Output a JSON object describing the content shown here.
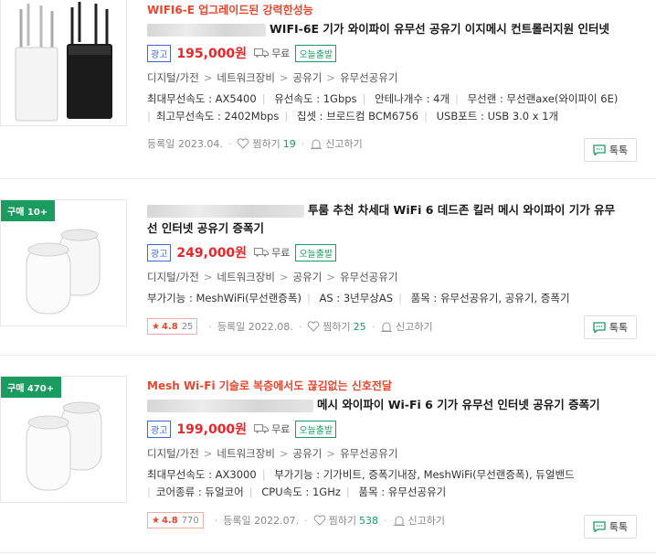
{
  "products": [
    {
      "badge": "",
      "promo": "WIFI6-E 업그레이드된 강력한성능",
      "title": "WIFI-6E 기가 와이파이 유무선 공유기 이지메시 컨트롤러지원 인터넷",
      "title2": "",
      "ad_label": "광고",
      "price": "195,000원",
      "shipping": "무료",
      "today": "오늘출발",
      "categories": [
        "디지털/가전",
        "네트워크장비",
        "공유기",
        "유무선공유기"
      ],
      "specs_line1": [
        "최대무선속도 : AX5400",
        "유선속도 : 1Gbps",
        "안테나개수 : 4개",
        "무선랜 : 무선랜axe(와이파이 6E)"
      ],
      "specs_line2": [
        "최고무선속도 : 2402Mbps",
        "칩셋 : 브로드컴 BCM6756",
        "USB포트 : USB 3.0 x 1개"
      ],
      "rating": "",
      "review_count": "",
      "date": "등록일 2023.04.",
      "wish_label": "찜하기",
      "wish_count": "19",
      "report": "신고하기",
      "talk": "톡톡"
    },
    {
      "badge": "구매 10+",
      "promo": "",
      "title": "투룸 추천 차세대 WiFi 6 데드존 킬러 메시 와이파이 기가 유무",
      "title2": "선 인터넷 공유기 증폭기",
      "ad_label": "광고",
      "price": "249,000원",
      "shipping": "무료",
      "today": "오늘출발",
      "categories": [
        "디지털/가전",
        "네트워크장비",
        "공유기",
        "유무선공유기"
      ],
      "specs_line1": [
        "부가기능 : MeshWiFi(무선랜증폭)",
        "AS : 3년무상AS",
        "품목 : 유무선공유기, 공유기, 증폭기"
      ],
      "specs_line2": [],
      "rating": "4.8",
      "review_count": "25",
      "date": "등록일 2022.08.",
      "wish_label": "찜하기",
      "wish_count": "25",
      "report": "신고하기",
      "talk": "톡톡"
    },
    {
      "badge": "구매 470+",
      "promo": "Mesh Wi-Fi 기술로 복층에서도 끊김없는 신호전달",
      "title": "메시 와이파이 Wi-Fi 6 기가 유무선 인터넷 공유기 증폭기",
      "title2": "",
      "ad_label": "광고",
      "price": "199,000원",
      "shipping": "무료",
      "today": "오늘출발",
      "categories": [
        "디지털/가전",
        "네트워크장비",
        "공유기",
        "유무선공유기"
      ],
      "specs_line1": [
        "최대무선속도 : AX3000",
        "부가기능 : 기가비트, 증폭기내장, MeshWiFi(무선랜증폭), 듀얼밴드"
      ],
      "specs_line2": [
        "코어종류 : 듀얼코어",
        "CPU속도 : 1GHz",
        "품목 : 유무선공유기"
      ],
      "rating": "4.8",
      "review_count": "770",
      "date": "등록일 2022.07.",
      "wish_label": "찜하기",
      "wish_count": "538",
      "report": "신고하기",
      "talk": "톡톡"
    }
  ]
}
